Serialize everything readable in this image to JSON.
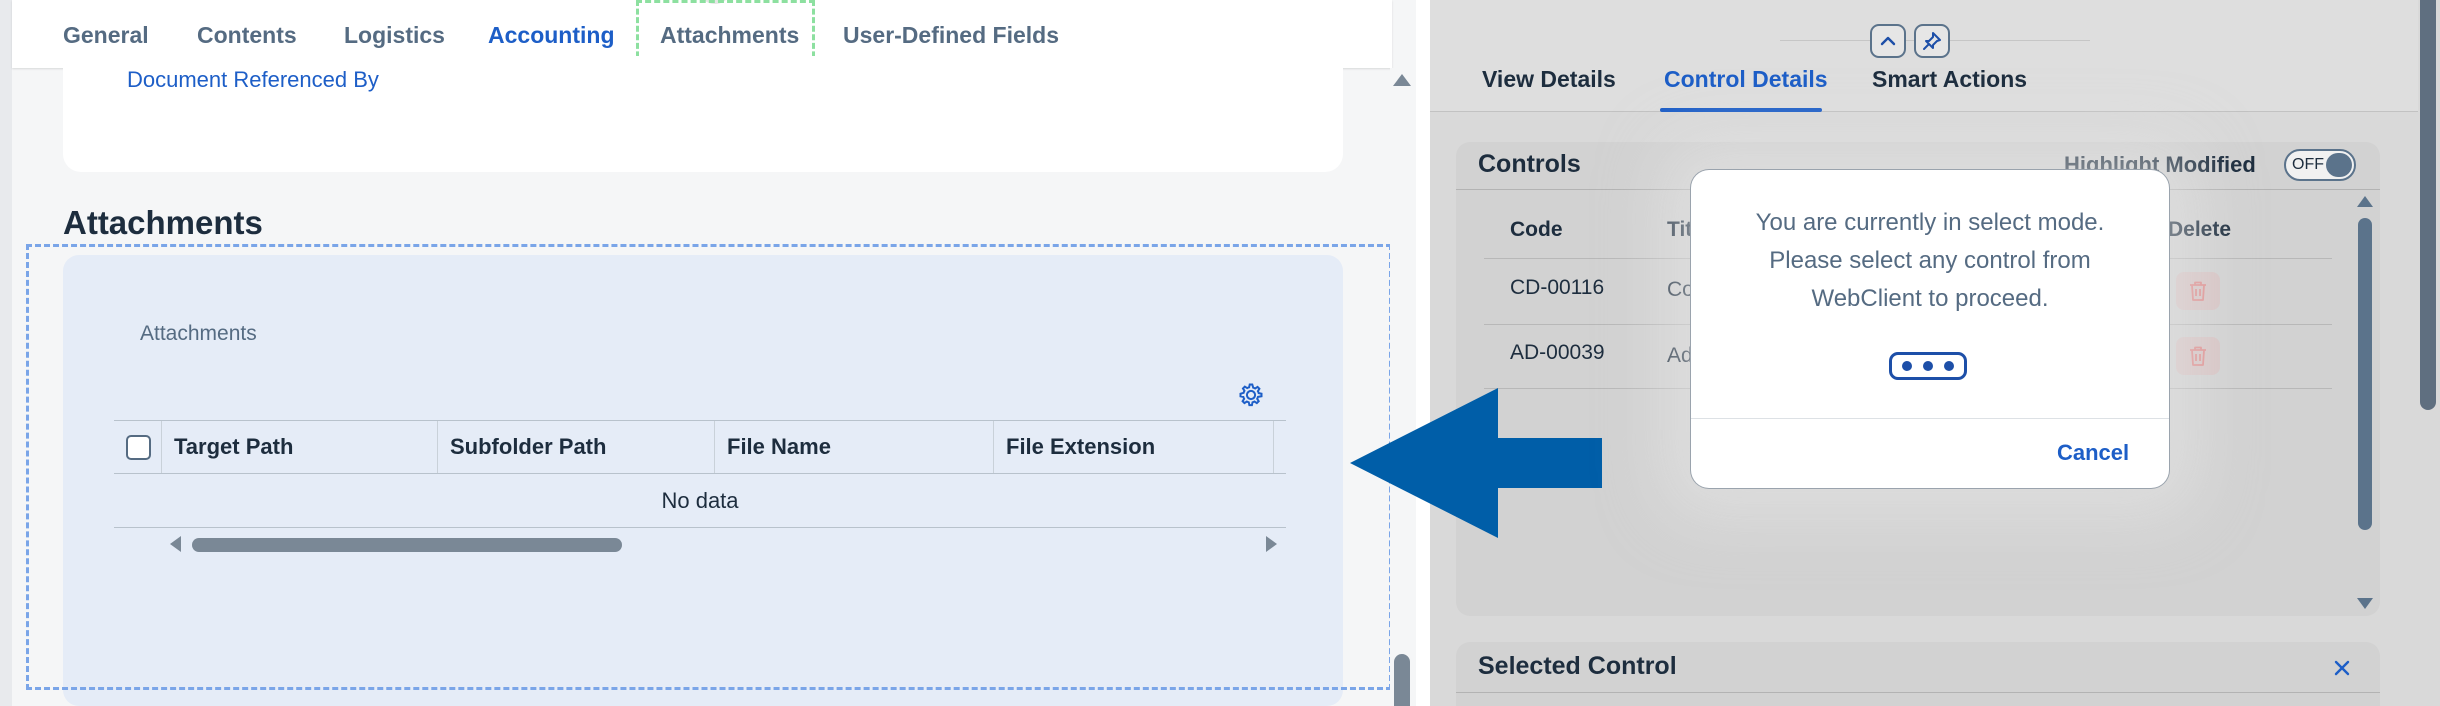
{
  "left": {
    "tabs": [
      {
        "label": "General"
      },
      {
        "label": "Contents"
      },
      {
        "label": "Logistics"
      },
      {
        "label": "Accounting"
      },
      {
        "label": "Attachments"
      },
      {
        "label": "User-Defined Fields"
      }
    ],
    "active_tab": "Accounting",
    "reference_link": "Document Referenced By",
    "section_title": "Attachments",
    "attachments_panel": {
      "label": "Attachments",
      "columns": [
        "Target Path",
        "Subfolder Path",
        "File Name",
        "File Extension"
      ],
      "empty_text": "No data"
    }
  },
  "right": {
    "tabs": [
      {
        "label": "View Details"
      },
      {
        "label": "Control Details"
      },
      {
        "label": "Smart Actions"
      }
    ],
    "active_tab": "Control Details",
    "controls": {
      "title": "Controls",
      "highlight_label": "Highlight Modified",
      "toggle_state": "OFF",
      "columns": {
        "code": "Code",
        "title": "Titl",
        "delete": "Delete"
      },
      "rows": [
        {
          "code": "CD-00116",
          "title": "Co"
        },
        {
          "code": "AD-00039",
          "title": "Ad"
        }
      ]
    },
    "selected_control": {
      "title": "Selected Control"
    }
  },
  "dialog": {
    "message_line1": "You are currently in select mode.",
    "message_line2": "Please select any control from",
    "message_line3": "WebClient to proceed.",
    "cancel_label": "Cancel"
  },
  "colors": {
    "accent": "#1d5ec7",
    "arrow": "#005ea8",
    "delete_icon": "#e08e8e"
  },
  "icons": {
    "gear": "gear-icon",
    "trash": "trash-icon",
    "pin": "pin-icon",
    "collapse": "chevron-up-icon",
    "close": "close-icon"
  }
}
